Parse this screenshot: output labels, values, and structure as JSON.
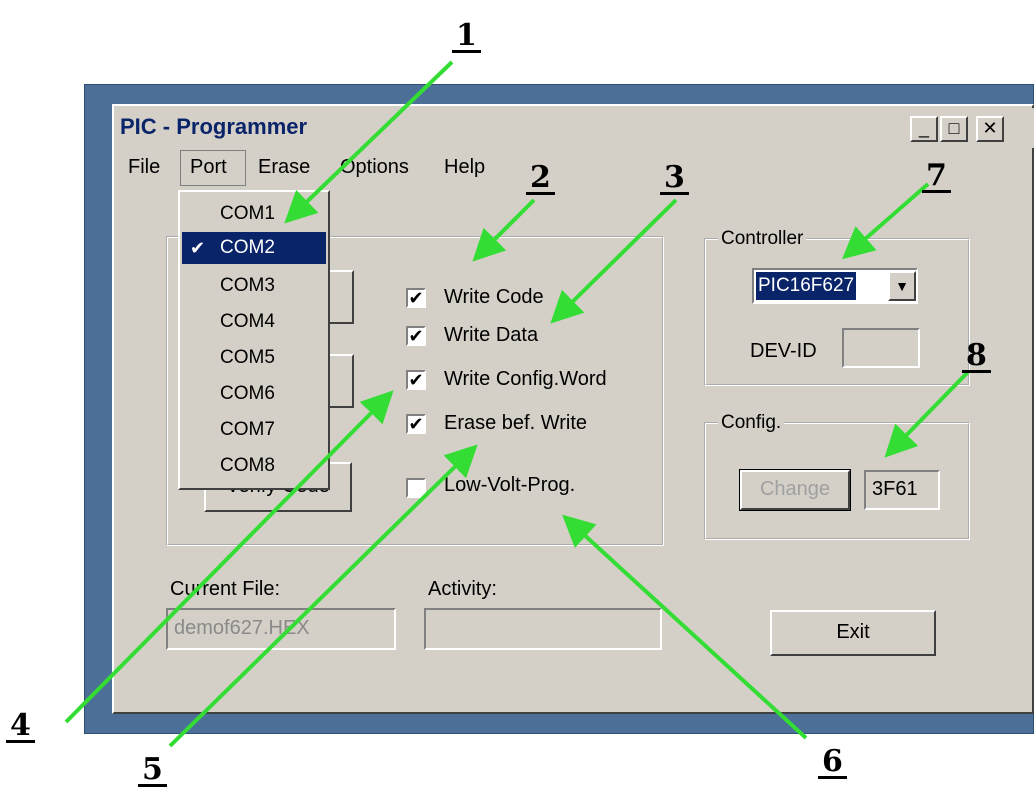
{
  "window": {
    "title": "PIC - Programmer"
  },
  "menu": [
    "File",
    "Port",
    "Erase",
    "Options",
    "Help"
  ],
  "port_menu": {
    "items": [
      "COM1",
      "COM2",
      "COM3",
      "COM4",
      "COM5",
      "COM6",
      "COM7",
      "COM8"
    ],
    "selected": "COM2",
    "check_glyph": "✔"
  },
  "hidden_button_text": "Verify Code",
  "options": [
    {
      "label": "Write Code",
      "checked": true
    },
    {
      "label": "Write Data",
      "checked": true
    },
    {
      "label": "Write Config.Word",
      "checked": true
    },
    {
      "label": "Erase bef. Write",
      "checked": true
    },
    {
      "label": "Low-Volt-Prog.",
      "checked": false
    }
  ],
  "check_mark": "✔",
  "controller": {
    "group_label": "Controller",
    "value": "PIC16F627",
    "devid_label": "DEV-ID",
    "devid_value": ""
  },
  "config": {
    "group_label": "Config.",
    "button": "Change",
    "value": "3F61"
  },
  "current_file": {
    "label": "Current File:",
    "value": "demof627.HEX"
  },
  "activity": {
    "label": "Activity:",
    "value": ""
  },
  "exit_button": "Exit",
  "caption_buttons": {
    "minimize": "_",
    "maximize": "□",
    "close": "✕"
  },
  "callouts": [
    "1",
    "2",
    "3",
    "4",
    "5",
    "6",
    "7",
    "8"
  ],
  "colors": {
    "arrow": "#33dd33",
    "title_text": "#0a246a",
    "selection": "#0a246a",
    "frame": "#4b6f97"
  }
}
